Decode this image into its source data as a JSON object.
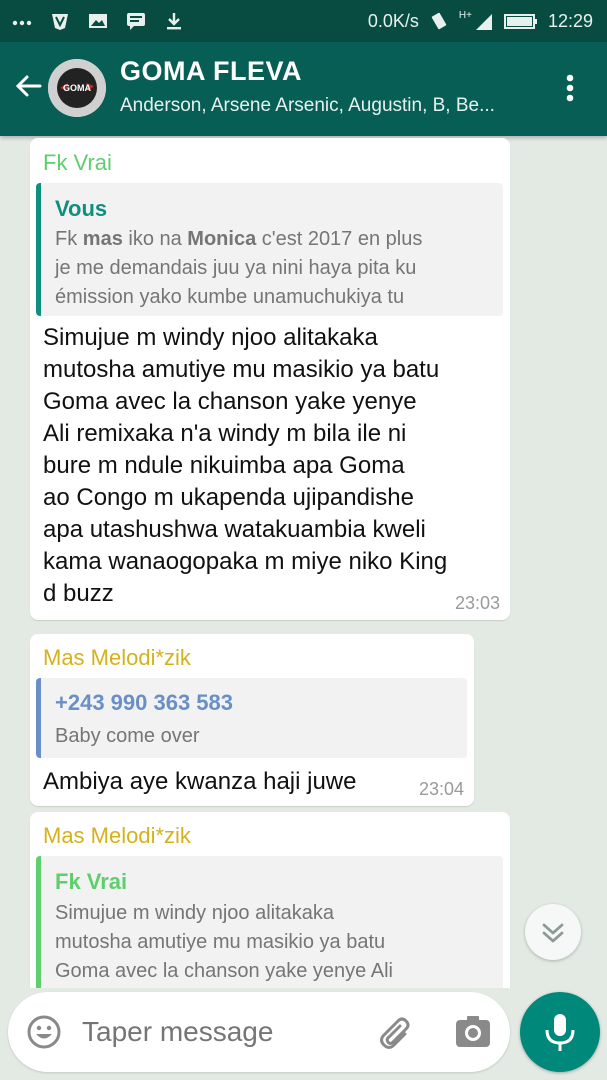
{
  "status_bar": {
    "net_speed": "0.0K/s",
    "network_type": "H+",
    "time": "12:29"
  },
  "header": {
    "title": "GOMA FLEVA",
    "subtitle": "Anderson, Arsene Arsenic, Augustin, B, Be...",
    "avatar_text": "GOMA"
  },
  "messages": [
    {
      "sender": "Fk Vrai",
      "quote_name": "Vous",
      "quote_lines": [
        [
          "Fk ",
          "mas",
          " iko na ",
          "Monica",
          " c'est 2017 en plus"
        ],
        "je me demandais juu ya nini haya pita ku",
        "émission yako kumbe unamuchukiya tu"
      ],
      "text_lines": [
        "Simujue m windy njoo alitakaka",
        "mutosha amutiye mu masikio ya batu",
        "Goma avec la chanson yake yenye",
        "Ali remixaka n'a windy m bila ile ni",
        "bure m ndule nikuimba apa Goma",
        "ao Congo m ukapenda ujipandishe",
        "apa utashushwa watakuambia kweli",
        "kama wanaogopaka m miye niko King",
        "d buzz"
      ],
      "time": "23:03"
    },
    {
      "sender": "Mas Melodi*zik",
      "quote_name": "+243 990 363 583",
      "quote_text": "Baby come over",
      "text": "Ambiya aye kwanza haji juwe",
      "time": "23:04"
    },
    {
      "sender": "Mas Melodi*zik",
      "quote_name": "Fk Vrai",
      "quote_lines": [
        "Simujue m windy njoo alitakaka",
        "mutosha amutiye mu masikio ya batu",
        "Goma avec la chanson yake yenye Ali"
      ]
    }
  ],
  "input": {
    "placeholder": "Taper message"
  },
  "colors": {
    "header": "#075e54",
    "status_bar": "#084c41",
    "chat_bg": "#e3eae4",
    "fk_vrai": "#5fcf6e",
    "mas_melodizik": "#d4b21a",
    "vous": "#0f8f7e",
    "phone": "#6a8fc6",
    "mic": "#00897b"
  },
  "icons": [
    "dots-icon",
    "shield-icon",
    "image-icon",
    "message-icon",
    "download-icon",
    "vibrate-icon",
    "signal-icon",
    "battery-icon",
    "back-arrow-icon",
    "more-vert-icon",
    "chevron-double-down-icon",
    "emoji-icon",
    "attach-icon",
    "camera-icon",
    "mic-icon"
  ]
}
